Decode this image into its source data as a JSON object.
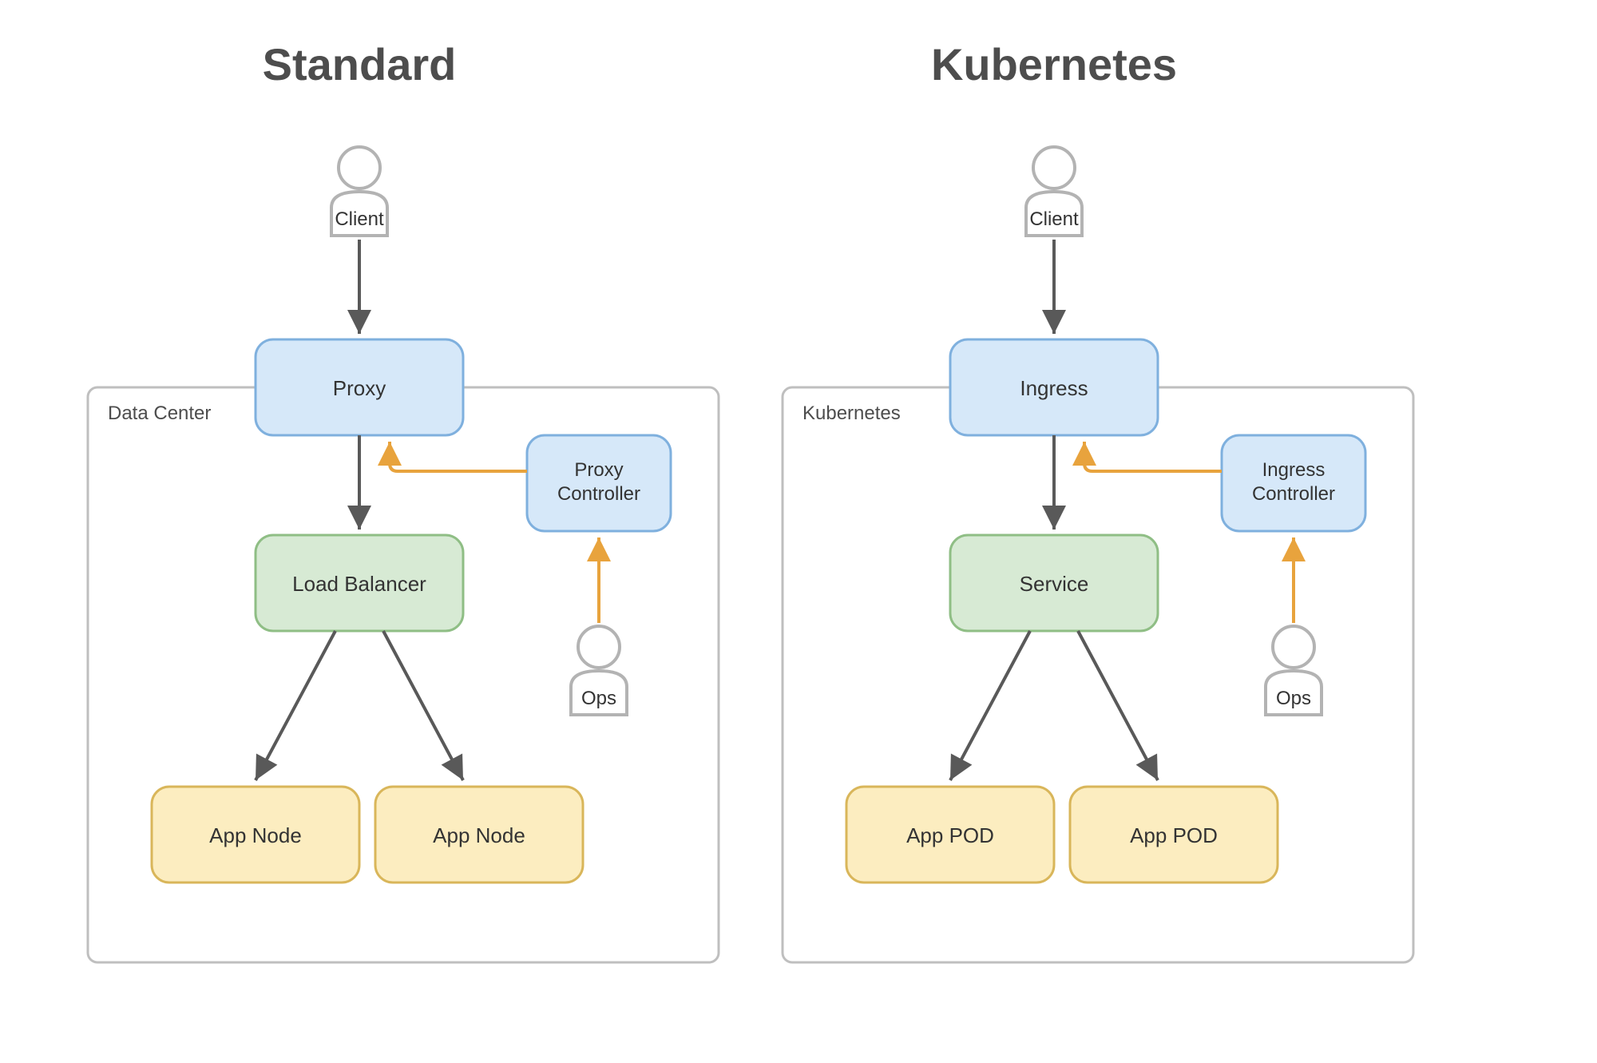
{
  "colors": {
    "blueFill": "#D6E8F9",
    "blueStroke": "#7FB0DE",
    "greenFill": "#D7EAD4",
    "greenStroke": "#8FBE85",
    "yellowFill": "#FCEDC0",
    "yellowStroke": "#D9B65A",
    "grayStroke": "#BFBFBF",
    "actorStroke": "#B3B3B3",
    "arrowDark": "#595959",
    "arrowOrange": "#E8A33D"
  },
  "left": {
    "title": "Standard",
    "container": "Data Center",
    "client": "Client",
    "proxy": "Proxy",
    "controller_line1": "Proxy",
    "controller_line2": "Controller",
    "balancer": "Load Balancer",
    "ops": "Ops",
    "app": "App Node"
  },
  "right": {
    "title": "Kubernetes",
    "container": "Kubernetes",
    "client": "Client",
    "proxy": "Ingress",
    "controller_line1": "Ingress",
    "controller_line2": "Controller",
    "balancer": "Service",
    "ops": "Ops",
    "app": "App POD"
  }
}
